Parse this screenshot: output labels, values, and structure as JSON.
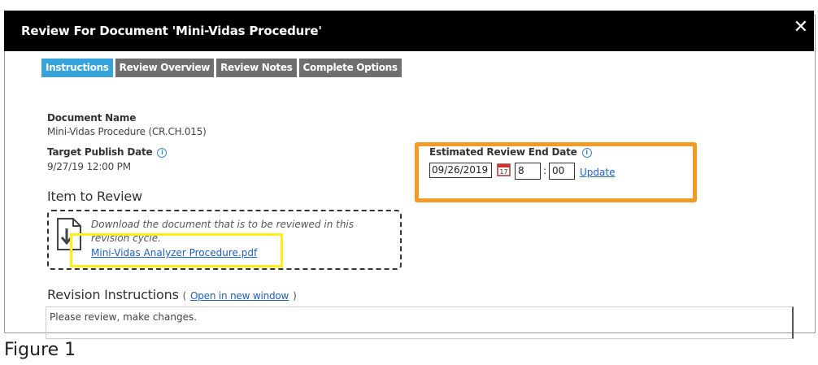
{
  "dialog": {
    "title": "Review For Document 'Mini-Vidas Procedure'",
    "close_glyph": "✕"
  },
  "tabs": [
    {
      "label": "Instructions",
      "active": true
    },
    {
      "label": "Review Overview",
      "active": false
    },
    {
      "label": "Review Notes",
      "active": false
    },
    {
      "label": "Complete Options",
      "active": false
    }
  ],
  "document": {
    "name_label": "Document Name",
    "name_value": "Mini-Vidas Procedure (CR.CH.015)",
    "target_label": "Target Publish Date",
    "target_value": "9/27/19 12:00 PM",
    "info_glyph": "i"
  },
  "estimated": {
    "label": "Estimated Review End Date",
    "date": "09/26/2019",
    "calendar_icon": "calendar-icon",
    "hour": "8",
    "colon": ":",
    "minute": "00",
    "update_label": "Update"
  },
  "item_to_review": {
    "heading": "Item to Review",
    "download_text": "Download the document that is to be reviewed in this revision cycle.",
    "file_link": "Mini-Vidas Analyzer Procedure.pdf",
    "icon": "download-document-icon"
  },
  "revision": {
    "heading": "Revision Instructions",
    "paren_open": "(",
    "link": "Open in new window",
    "paren_close": ")",
    "text": "Please review, make changes."
  },
  "caption": "Figure 1",
  "colors": {
    "tab_active": "#35a3dc",
    "tab_inactive": "#6f6f6f",
    "highlight_orange": "#f39a26",
    "highlight_yellow": "#ffef14",
    "link": "#1f5fc4"
  }
}
